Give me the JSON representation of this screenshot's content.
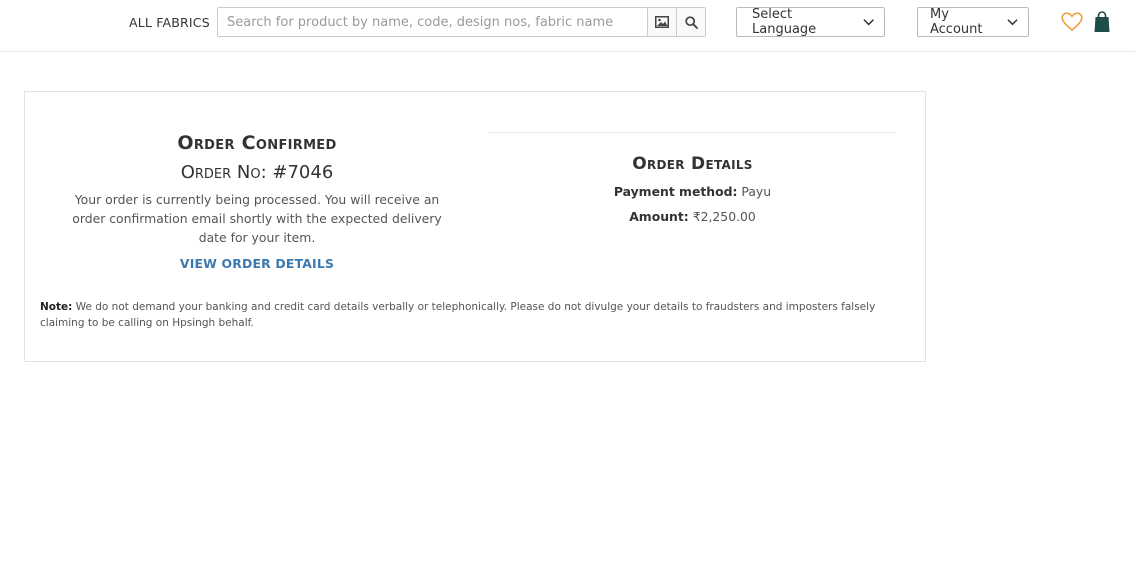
{
  "header": {
    "category_label": "ALL FABRICS",
    "search_placeholder": "Search for product by name, code, design nos, fabric name",
    "language_label": "Select Language",
    "account_label": "My Account",
    "icons": [
      "image-search-icon",
      "search-icon",
      "chevron-down-icon",
      "heart-icon",
      "shopping-bag-icon"
    ],
    "colors": {
      "heart": "#f0a040",
      "bag": "#1f4d4a"
    }
  },
  "order": {
    "confirmed_title": "Order Confirmed",
    "number_label": "Order No:",
    "number_value": "#7046",
    "message": "Your order is currently being processed. You will receive an order confirmation email shortly with the expected delivery date for your item.",
    "view_link": "VIEW ORDER DETAILS",
    "link_color": "#3b79ae"
  },
  "details": {
    "title": "Order Details",
    "payment_label": "Payment method:",
    "payment_value": "Payu",
    "amount_label": "Amount:",
    "amount_value": "₹2,250.00"
  },
  "note": {
    "label": "Note:",
    "text": "We do not demand your banking and credit card details verbally or telephonically. Please do not divulge your details to fraudsters and imposters falsely claiming to be calling on Hpsingh behalf."
  }
}
